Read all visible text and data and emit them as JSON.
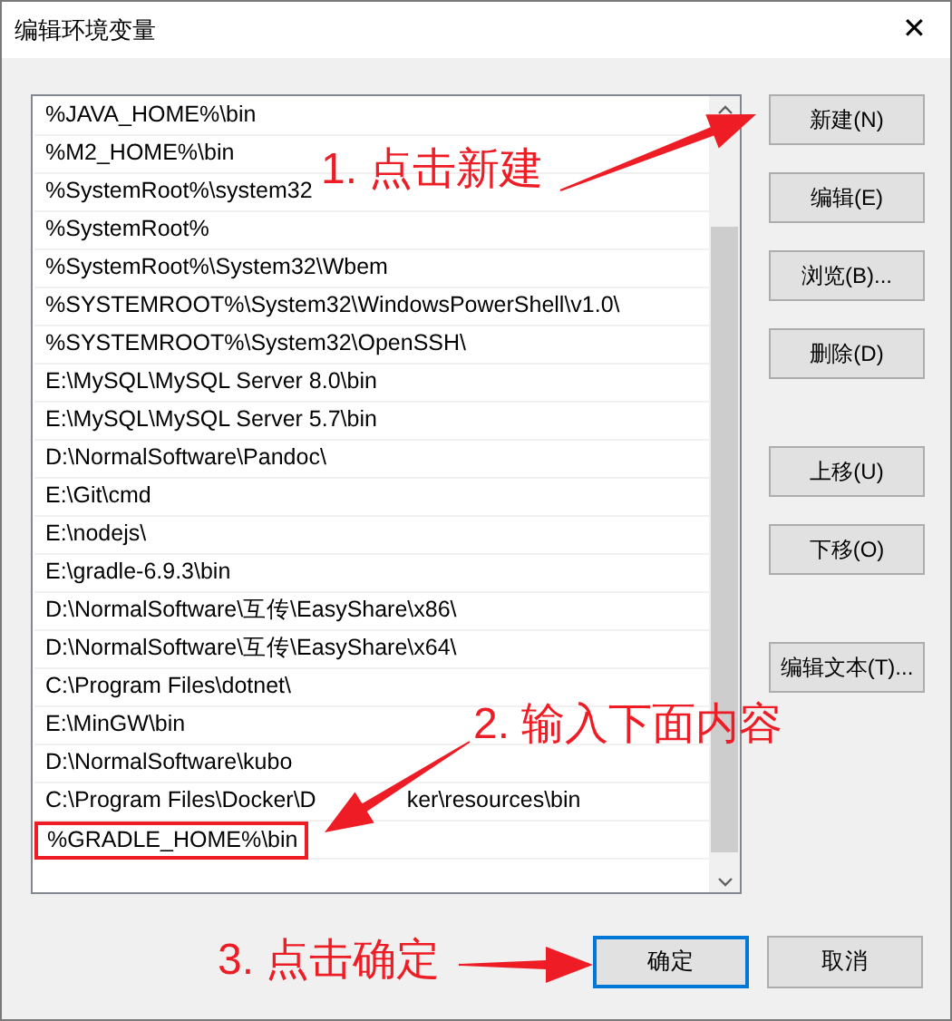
{
  "window": {
    "title": "编辑环境变量",
    "close": "✕"
  },
  "list": {
    "items": [
      {
        "text": "%JAVA_HOME%\\bin",
        "highlighted": false
      },
      {
        "text": "%M2_HOME%\\bin",
        "highlighted": false
      },
      {
        "text": "%SystemRoot%\\system32",
        "highlighted": false
      },
      {
        "text": "%SystemRoot%",
        "highlighted": false
      },
      {
        "text": "%SystemRoot%\\System32\\Wbem",
        "highlighted": false
      },
      {
        "text": "%SYSTEMROOT%\\System32\\WindowsPowerShell\\v1.0\\",
        "highlighted": false
      },
      {
        "text": "%SYSTEMROOT%\\System32\\OpenSSH\\",
        "highlighted": false
      },
      {
        "text": "E:\\MySQL\\MySQL Server 8.0\\bin",
        "highlighted": false
      },
      {
        "text": "E:\\MySQL\\MySQL Server 5.7\\bin",
        "highlighted": false
      },
      {
        "text": "D:\\NormalSoftware\\Pandoc\\",
        "highlighted": false
      },
      {
        "text": "E:\\Git\\cmd",
        "highlighted": false
      },
      {
        "text": "E:\\nodejs\\",
        "highlighted": false
      },
      {
        "text": "E:\\gradle-6.9.3\\bin",
        "highlighted": false
      },
      {
        "text": "D:\\NormalSoftware\\互传\\EasyShare\\x86\\",
        "highlighted": false
      },
      {
        "text": "D:\\NormalSoftware\\互传\\EasyShare\\x64\\",
        "highlighted": false
      },
      {
        "text": "C:\\Program Files\\dotnet\\",
        "highlighted": false
      },
      {
        "text": "E:\\MinGW\\bin",
        "highlighted": false
      },
      {
        "text": "D:\\NormalSoftware\\kubo",
        "highlighted": false
      },
      {
        "text": "C:\\Program Files\\Docker\\D",
        "text_after": "ker\\resources\\bin",
        "highlighted": false
      },
      {
        "text": "%GRADLE_HOME%\\bin",
        "highlighted": true
      }
    ]
  },
  "side_buttons": [
    {
      "label": "新建(N)"
    },
    {
      "label": "编辑(E)"
    },
    {
      "label": "浏览(B)..."
    },
    {
      "label": "删除(D)"
    },
    {
      "label": "上移(U)"
    },
    {
      "label": "下移(O)"
    },
    {
      "label": "编辑文本(T)..."
    }
  ],
  "bottom_buttons": [
    {
      "label": "确定",
      "default": true
    },
    {
      "label": "取消",
      "default": false
    }
  ],
  "annotations": [
    {
      "text": "1. 点击新建"
    },
    {
      "text": "2. 输入下面内容"
    },
    {
      "text": "3. 点击确定"
    }
  ]
}
